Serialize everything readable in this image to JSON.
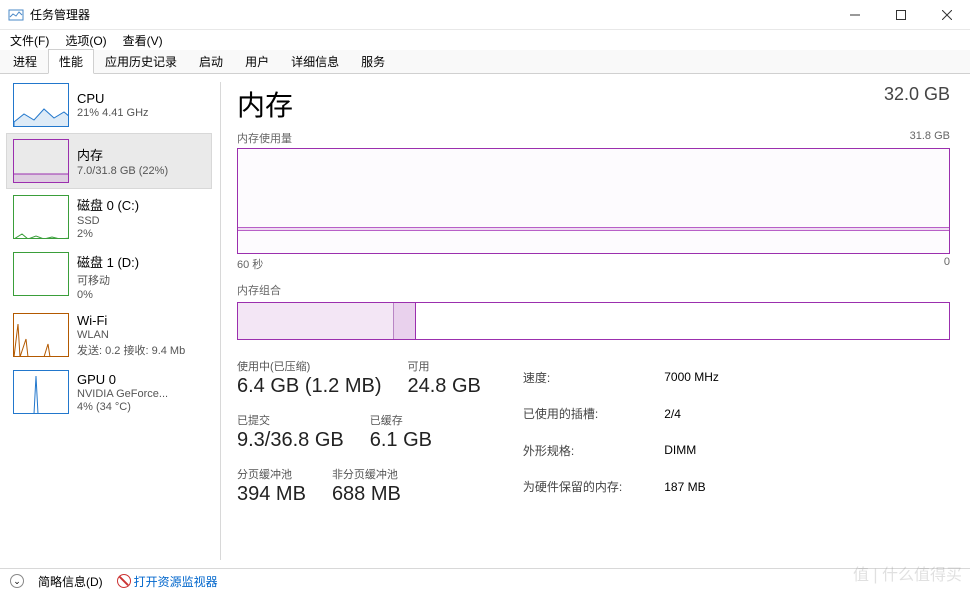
{
  "window": {
    "title": "任务管理器"
  },
  "menu": {
    "file": "文件(F)",
    "options": "选项(O)",
    "view": "查看(V)"
  },
  "tabs": {
    "processes": "进程",
    "performance": "性能",
    "history": "应用历史记录",
    "startup": "启动",
    "users": "用户",
    "details": "详细信息",
    "services": "服务"
  },
  "sidebar": {
    "cpu": {
      "name": "CPU",
      "sub": "21% 4.41 GHz"
    },
    "memory": {
      "name": "内存",
      "sub": "7.0/31.8 GB (22%)"
    },
    "disk0": {
      "name": "磁盘 0 (C:)",
      "sub1": "SSD",
      "sub2": "2%"
    },
    "disk1": {
      "name": "磁盘 1 (D:)",
      "sub1": "可移动",
      "sub2": "0%"
    },
    "wifi": {
      "name": "Wi-Fi",
      "sub1": "WLAN",
      "sub2": "发送: 0.2 接收: 9.4 Mb"
    },
    "gpu": {
      "name": "GPU 0",
      "sub1": "NVIDIA GeForce...",
      "sub2": "4% (34 °C)"
    }
  },
  "main": {
    "title": "内存",
    "total": "32.0 GB",
    "usage_label": "内存使用量",
    "usage_max": "31.8 GB",
    "axis_left": "60 秒",
    "axis_right": "0",
    "comp_label": "内存组合",
    "stats": {
      "in_use_label": "使用中(已压缩)",
      "in_use_value": "6.4 GB (1.2 MB)",
      "available_label": "可用",
      "available_value": "24.8 GB",
      "committed_label": "已提交",
      "committed_value": "9.3/36.8 GB",
      "cached_label": "已缓存",
      "cached_value": "6.1 GB",
      "paged_label": "分页缓冲池",
      "paged_value": "394 MB",
      "nonpaged_label": "非分页缓冲池",
      "nonpaged_value": "688 MB"
    },
    "info": {
      "speed_label": "速度:",
      "speed_value": "7000 MHz",
      "slots_label": "已使用的插槽:",
      "slots_value": "2/4",
      "form_label": "外形规格:",
      "form_value": "DIMM",
      "reserved_label": "为硬件保留的内存:",
      "reserved_value": "187 MB"
    }
  },
  "footer": {
    "brief": "简略信息(D)",
    "resmon": "打开资源监视器"
  },
  "chart_data": {
    "type": "line",
    "title": "内存使用量",
    "ylabel": "GB",
    "ylim": [
      0,
      31.8
    ],
    "xlabel": "秒",
    "xlim": [
      60,
      0
    ],
    "series": [
      {
        "name": "内存",
        "values_gb_approx": 7.0,
        "flat": true
      }
    ],
    "composition": {
      "in_use_pct": 22,
      "modified_pct": 3,
      "standby_free_pct": 75
    }
  }
}
